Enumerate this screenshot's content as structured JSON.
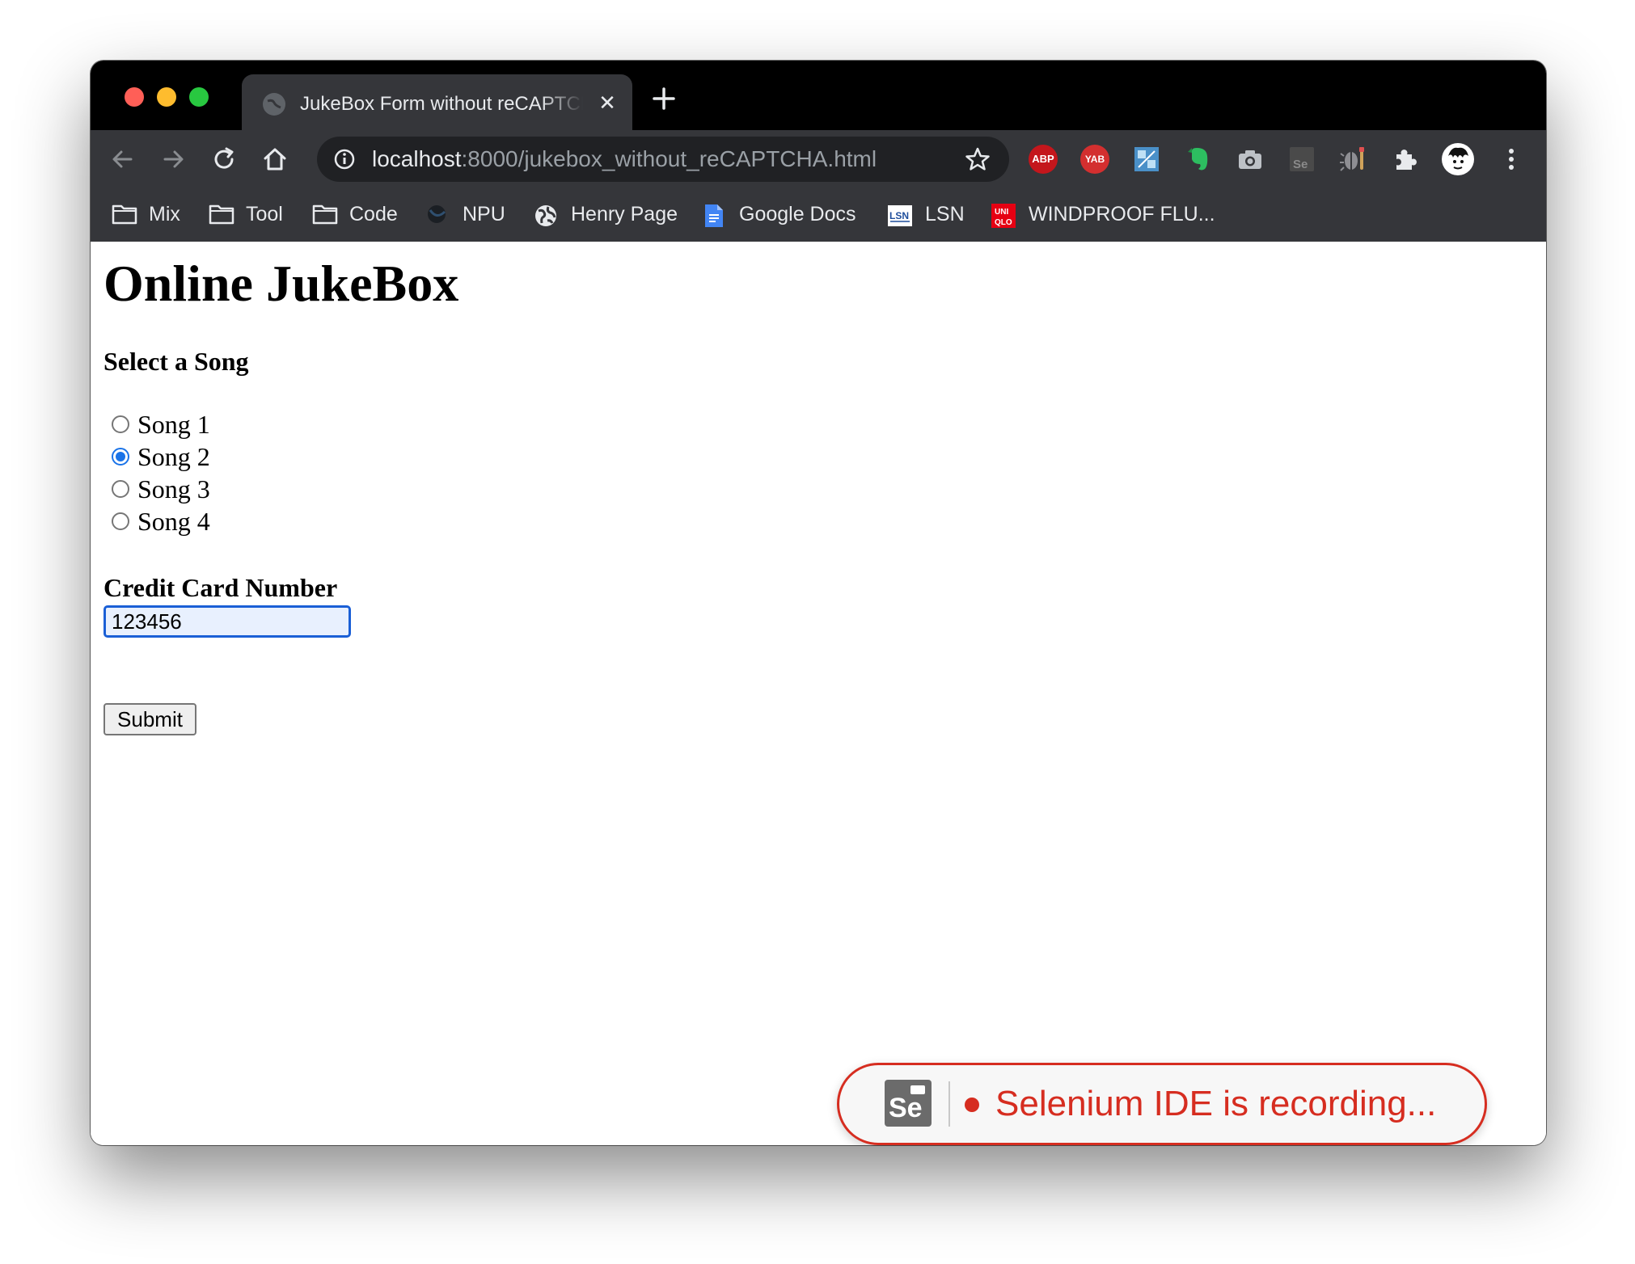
{
  "browser": {
    "tab": {
      "title": "JukeBox Form without reCAPTCHA",
      "close_glyph": "✕"
    },
    "new_tab_icon": "plus-icon",
    "address_bar": {
      "host": "localhost",
      "path": ":8000/jukebox_without_reCAPTCHA.html"
    },
    "extensions": [
      {
        "name": "adblock-plus-icon",
        "label": "ABP",
        "color": "#c4161c"
      },
      {
        "name": "yab-icon",
        "label": "YAB",
        "color": "#d32f2f"
      },
      {
        "name": "translate-extension-icon"
      },
      {
        "name": "evernote-icon",
        "color": "#2dbe60"
      },
      {
        "name": "camera-icon"
      },
      {
        "name": "selenium-ide-icon",
        "label": "Se"
      },
      {
        "name": "bug-extension-icon"
      },
      {
        "name": "puzzle-extensions-icon"
      },
      {
        "name": "profile-avatar-icon"
      },
      {
        "name": "menu-kebab-icon"
      }
    ],
    "bookmarks": [
      {
        "label": "Mix",
        "icon": "folder-icon"
      },
      {
        "label": "Tool",
        "icon": "folder-icon"
      },
      {
        "label": "Code",
        "icon": "folder-icon"
      },
      {
        "label": "NPU",
        "icon": "npu-favicon-icon"
      },
      {
        "label": "Henry Page",
        "icon": "globe-icon"
      },
      {
        "label": "Google Docs",
        "icon": "google-docs-icon"
      },
      {
        "label": "LSN",
        "icon": "lsn-favicon-icon"
      },
      {
        "label": "WINDPROOF FLU...",
        "icon": "uniqlo-favicon-icon"
      }
    ]
  },
  "page": {
    "title": "Online JukeBox",
    "song_section_label": "Select a Song",
    "songs": [
      {
        "label": "Song 1",
        "checked": false
      },
      {
        "label": "Song 2",
        "checked": true
      },
      {
        "label": "Song 3",
        "checked": false
      },
      {
        "label": "Song 4",
        "checked": false
      }
    ],
    "credit_card_label": "Credit Card Number",
    "credit_card_value": "123456",
    "submit_label": "Submit"
  },
  "selenium_overlay": {
    "logo_text": "Se",
    "status_text": "Selenium IDE is recording..."
  }
}
